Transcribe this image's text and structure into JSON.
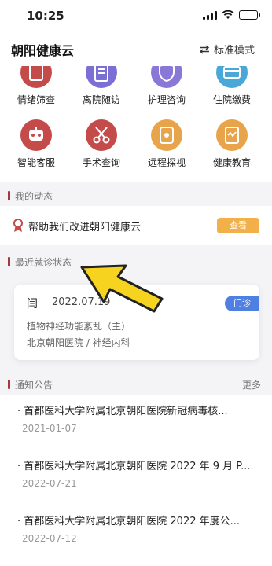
{
  "status": {
    "time": "10:25"
  },
  "header": {
    "title": "朝阳健康云",
    "mode_label": "标准模式"
  },
  "grid": {
    "items": [
      {
        "label": "情绪筛查",
        "icon": "clipboard-icon",
        "color": "#c54b4b"
      },
      {
        "label": "离院随访",
        "icon": "document-icon",
        "color": "#7b6fd6"
      },
      {
        "label": "护理咨询",
        "icon": "shield-icon",
        "color": "#8a78d6"
      },
      {
        "label": "住院缴费",
        "icon": "card-icon",
        "color": "#4aa8d8"
      },
      {
        "label": "智能客服",
        "icon": "robot-icon",
        "color": "#c54b4b"
      },
      {
        "label": "手术查询",
        "icon": "scissors-icon",
        "color": "#c54b4b"
      },
      {
        "label": "远程探视",
        "icon": "video-icon",
        "color": "#e7a44a"
      },
      {
        "label": "健康教育",
        "icon": "book-icon",
        "color": "#e7a44a"
      }
    ]
  },
  "my_activity": {
    "title": "我的动态",
    "text": "帮助我们改进朝阳健康云",
    "button": "查看",
    "icon": "ribbon-icon"
  },
  "recent_visit": {
    "title": "最近就诊状态",
    "name": "闫",
    "date": "2022.07.19",
    "badge": "门诊",
    "diagnosis": "植物神经功能紊乱（主）",
    "department": "北京朝阳医院 / 神经内科"
  },
  "notices": {
    "title": "通知公告",
    "more": "更多",
    "items": [
      {
        "title": "· 首都医科大学附属北京朝阳医院新冠病毒核...",
        "date": "2021-01-07"
      },
      {
        "title": "· 首都医科大学附属北京朝阳医院 2022 年 9 月 P...",
        "date": "2022-07-21"
      },
      {
        "title": "· 首都医科大学附属北京朝阳医院 2022 年度公...",
        "date": "2022-07-12"
      }
    ]
  },
  "colors": {
    "accent": "#a33a3a",
    "badge_blue": "#4f7fe0",
    "button_orange": "#f2b04a",
    "pointer": "#f5d31f"
  }
}
